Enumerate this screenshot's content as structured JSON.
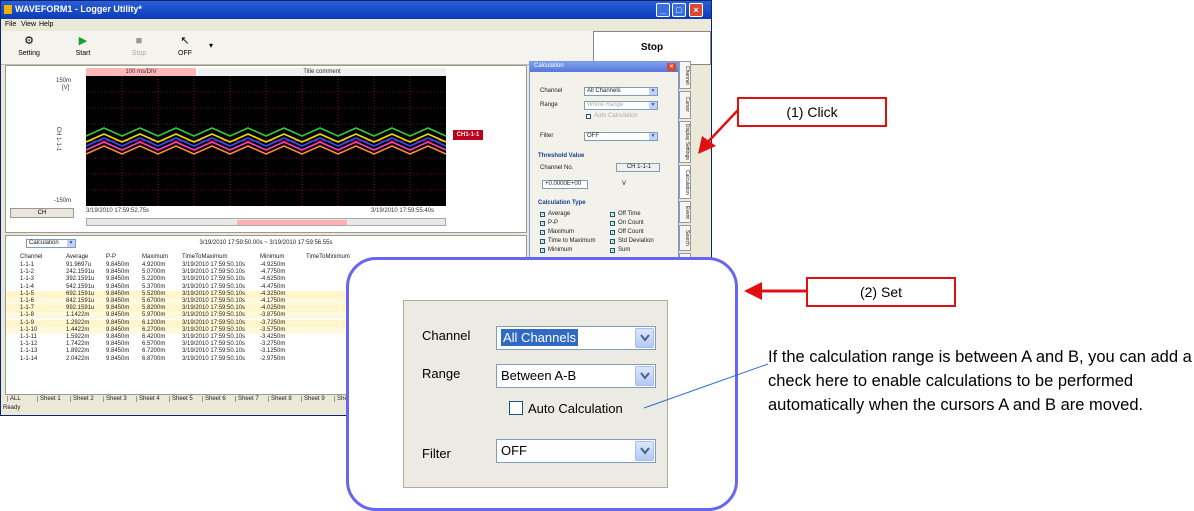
{
  "window": {
    "title": "WAVEFORM1 - Logger Utility*",
    "menu": [
      "File",
      "View",
      "Help"
    ],
    "toolbar": [
      {
        "label": "Setting",
        "icon": "gear-icon"
      },
      {
        "label": "Start",
        "icon": "play-icon"
      },
      {
        "label": "Stop",
        "icon": "stop-square-icon"
      },
      {
        "label": "OFF",
        "icon": "cursor-arrow-icon"
      }
    ],
    "stop_label": "Stop"
  },
  "wave": {
    "time_div": "100 ms/DIV",
    "title_comment": "Title comment",
    "y_top": "150m",
    "y_unit": "[V]",
    "y_bottom": "-150m",
    "y_axis_name": "CH 1-1-1",
    "channel_button": "CH",
    "start_time": "3/19/2010 17:59:52.75s",
    "end_time": "3/19/2010 17:59:55.40s",
    "ch_tag": "CH1-1-1"
  },
  "table": {
    "view_select": "Calculation",
    "range_text": "3/19/2010 17:59:50.00s ~ 3/19/2010 17:59:56.55s",
    "columns": [
      "Channel",
      "Average",
      "P-P",
      "Maximum",
      "TimeToMaximum",
      "Minimum",
      "TimeToMinimum"
    ],
    "rows": [
      [
        "1-1-1",
        "91.9697u",
        "9.8450m",
        "4.9200m",
        "3/19/2010 17:59:50.10s",
        "-4.9250m"
      ],
      [
        "1-1-2",
        "242.1591u",
        "9.8450m",
        "5.0700m",
        "3/19/2010 17:59:50.10s",
        "-4.7750m"
      ],
      [
        "1-1-3",
        "392.1591u",
        "9.8450m",
        "5.2200m",
        "3/19/2010 17:59:50.10s",
        "-4.6250m"
      ],
      [
        "1-1-4",
        "542.1591u",
        "9.8450m",
        "5.3700m",
        "3/19/2010 17:59:50.10s",
        "-4.4750m"
      ],
      [
        "1-1-5",
        "692.1591u",
        "9.8450m",
        "5.5200m",
        "3/19/2010 17:59:50.10s",
        "-4.3250m"
      ],
      [
        "1-1-6",
        "842.1591u",
        "9.8450m",
        "5.6700m",
        "3/19/2010 17:59:50.10s",
        "-4.1750m"
      ],
      [
        "1-1-7",
        "992.1591u",
        "9.8450m",
        "5.8200m",
        "3/19/2010 17:59:50.10s",
        "-4.0250m"
      ],
      [
        "1-1-8",
        "1.1422m",
        "9.8450m",
        "5.9700m",
        "3/19/2010 17:59:50.10s",
        "-3.8750m"
      ],
      [
        "1-1-9",
        "1.2922m",
        "9.8450m",
        "6.1200m",
        "3/19/2010 17:59:50.10s",
        "-3.7250m"
      ],
      [
        "1-1-10",
        "1.4422m",
        "9.8450m",
        "6.2700m",
        "3/19/2010 17:59:50.10s",
        "-3.5750m"
      ],
      [
        "1-1-11",
        "1.5922m",
        "9.8450m",
        "6.4200m",
        "3/19/2010 17:59:50.10s",
        "-3.4250m"
      ],
      [
        "1-1-12",
        "1.7422m",
        "9.8450m",
        "6.5700m",
        "3/19/2010 17:59:50.10s",
        "-3.2750m"
      ],
      [
        "1-1-13",
        "1.8922m",
        "9.8450m",
        "6.7200m",
        "3/19/2010 17:59:50.10s",
        "-3.1250m"
      ],
      [
        "1-1-14",
        "2.0422m",
        "9.8450m",
        "6.8700m",
        "3/19/2010 17:59:50.10s",
        "-2.9750m"
      ]
    ],
    "sheets": [
      "ALL",
      "Sheet 1",
      "Sheet 2",
      "Sheet 3",
      "Sheet 4",
      "Sheet 5",
      "Sheet 6",
      "Sheet 7",
      "Sheet 8",
      "Sheet 9",
      "She"
    ],
    "status": "Ready"
  },
  "calc_panel": {
    "title": "Calculation",
    "channel_label": "Channel",
    "channel_value": "All Channels",
    "range_label": "Range",
    "range_value": "Whole Range",
    "auto_calc": "Auto Calculation",
    "filter_label": "Filter",
    "filter_value": "OFF",
    "threshold_title": "Threshold Value",
    "channel_no_label": "Channel No.",
    "channel_no_value": "CH 1-1-1",
    "threshold_value": "+0.0000E+00",
    "threshold_unit": "V",
    "calc_type_title": "Calculation Type",
    "types_left": [
      "Average",
      "P-P",
      "Maximum",
      "Time to Maximum",
      "Minimum"
    ],
    "types_right": [
      "Off Time",
      "On Count",
      "Off Count",
      "Std Deviation",
      "Sum"
    ],
    "side_tabs": [
      "Channel",
      "Cursor",
      "Display Settings",
      "Calculation",
      "Event",
      "Search",
      "Overlay"
    ]
  },
  "callouts": {
    "click": "(1) Click",
    "set": "(2) Set"
  },
  "zoom": {
    "channel_label": "Channel",
    "channel_value": "All Channels",
    "range_label": "Range",
    "range_value": "Between A-B",
    "auto_calc": "Auto Calculation",
    "filter_label": "Filter",
    "filter_value": "OFF"
  },
  "note": "If the calculation range is between A and B, you can add a check here to enable calculations to be performed automatically when the cursors A and B are moved."
}
